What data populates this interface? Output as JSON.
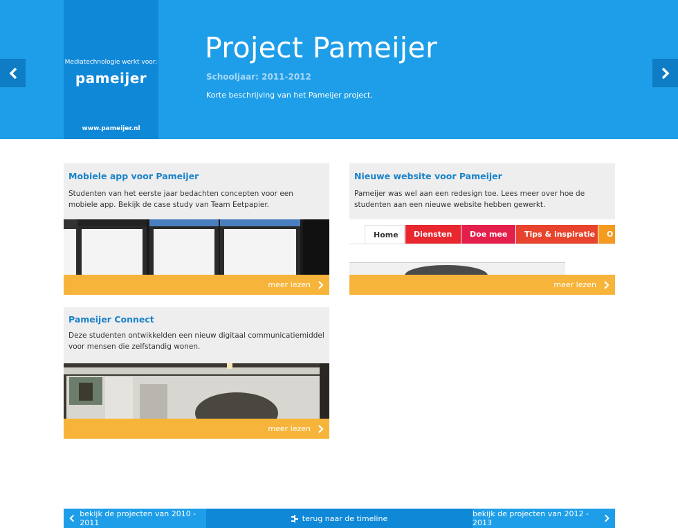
{
  "header": {
    "client_works_for": "Mediatechnologie werkt voor:",
    "client_logo": "pameijer",
    "client_url": "www.pameijer.nl",
    "title": "Project Pameijer",
    "school_year": "Schooljaar: 2011-2012",
    "description": "Korte beschrijving van het Pameijer project."
  },
  "cards": [
    {
      "title": "Mobiele app voor Pameijer",
      "text": "Studenten van het eerste jaar bedachten concepten voor een mobiele app. Bekijk de case study van Team Eetpapier.",
      "footer": "meer lezen"
    },
    {
      "title": "Nieuwe website voor Pameijer",
      "text": "Pameijer was wel aan een redesign toe. Lees meer over hoe de studenten aan een nieuwe website hebben gewerkt.",
      "footer": "meer lezen",
      "site_tabs": [
        "Home",
        "Diensten",
        "Doe mee",
        "Tips & inspiratie",
        "O"
      ]
    },
    {
      "title": "Pameijer Connect",
      "text": "Deze studenten ontwikkelden een nieuw digitaal communicatiemiddel voor mensen die zelfstandig wonen.",
      "footer": "meer lezen"
    }
  ],
  "bottom": {
    "prev": "bekijk de projecten van 2010 - 2011",
    "timeline": "terug naar de timeline",
    "next": "bekijk de projecten van 2012 - 2013"
  },
  "colors": {
    "header_blue": "#1e9ee8",
    "dark_blue": "#0f88d8",
    "accent_orange": "#f7b43b",
    "title_blue": "#1a82c9"
  }
}
